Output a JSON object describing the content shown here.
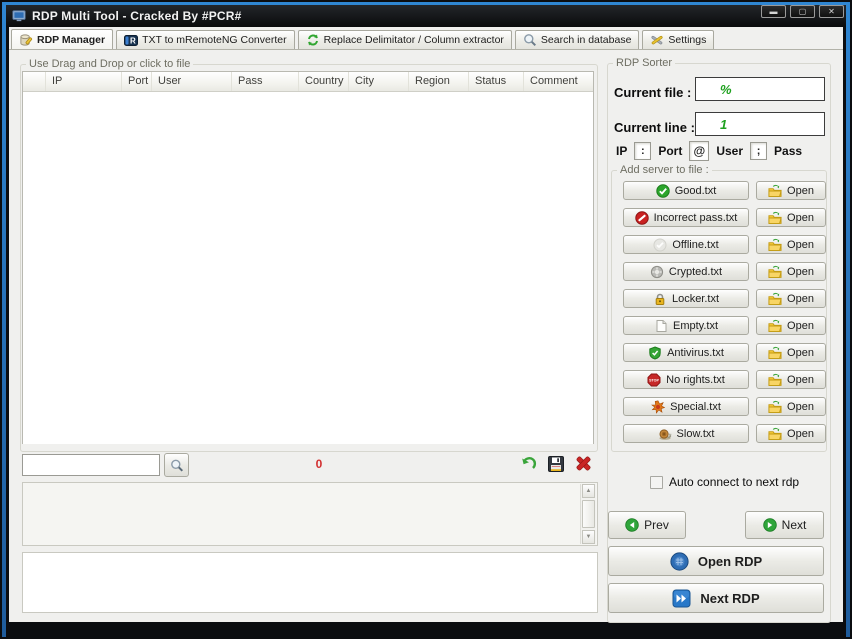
{
  "window": {
    "title": "RDP Multi Tool - Cracked By #PCR#",
    "minimize_glyph": "▬",
    "maximize_glyph": "▢",
    "close_glyph": "✕"
  },
  "tabs": [
    {
      "label": "RDP Manager",
      "icon": "database-icon",
      "active": true
    },
    {
      "label": "TXT to mRemoteNG Converter",
      "icon": "mremoteng-icon",
      "active": false
    },
    {
      "label": "Replace Delimitator / Column extractor",
      "icon": "recycle-icon",
      "active": false
    },
    {
      "label": "Search in database",
      "icon": "search-icon",
      "active": false
    },
    {
      "label": "Settings",
      "icon": "tools-icon",
      "active": false
    }
  ],
  "drop_group": {
    "label": "Use Drag and Drop or click to file"
  },
  "table": {
    "columns": [
      "",
      "IP",
      "Port",
      "User",
      "Pass",
      "Country",
      "City",
      "Region",
      "Status",
      "Comment"
    ],
    "rows": []
  },
  "search": {
    "value": "",
    "count": "0"
  },
  "icons": {
    "undo": "undo-icon",
    "save": "save-icon",
    "delete": "delete-icon",
    "magnifier": "search-icon"
  },
  "sorter": {
    "label": "RDP Sorter",
    "current_file": {
      "label": "Current file :",
      "value": "%"
    },
    "current_line": {
      "label": "Current line :",
      "value": "1"
    },
    "format": {
      "ip": "IP",
      "colon": ":",
      "port": "Port",
      "at": "@",
      "user": "User",
      "semicolon": ";",
      "pass": "Pass"
    },
    "add_group": {
      "label": "Add server to file :",
      "open_label": "Open",
      "files": [
        {
          "label": "Good.txt",
          "icon": "good-check-icon"
        },
        {
          "label": "Incorrect pass.txt",
          "icon": "incorrect-pass-icon"
        },
        {
          "label": "Offline.txt",
          "icon": "offline-icon"
        },
        {
          "label": "Crypted.txt",
          "icon": "crypted-gear-icon"
        },
        {
          "label": "Locker.txt",
          "icon": "locker-padlock-icon"
        },
        {
          "label": "Empty.txt",
          "icon": "empty-page-icon"
        },
        {
          "label": "Antivirus.txt",
          "icon": "antivirus-shield-icon"
        },
        {
          "label": "No rights.txt",
          "icon": "no-rights-stop-icon"
        },
        {
          "label": "Special.txt",
          "icon": "special-star-icon"
        },
        {
          "label": "Slow.txt",
          "icon": "slow-snail-icon"
        }
      ]
    },
    "auto_connect_label": "Auto connect to next rdp",
    "prev_label": "Prev",
    "next_label": "Next",
    "open_rdp_label": "Open RDP",
    "next_rdp_label": "Next RDP"
  },
  "colors": {
    "accent_blue": "#2f86d2",
    "value_green": "#1fa11f",
    "count_red": "#d22f2f",
    "folder_yellow": "#f3c73a",
    "good_green": "#2ba52b",
    "error_red": "#c92121"
  }
}
